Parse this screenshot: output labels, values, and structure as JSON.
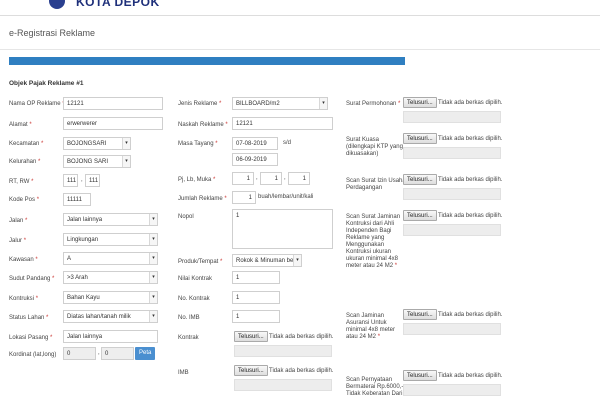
{
  "header": {
    "logo_text": "KOTA DEPOK"
  },
  "page": {
    "title": "e-Registrasi Reklame",
    "progress_percent": 100
  },
  "section": {
    "title": "Objek Pajak Reklame #1"
  },
  "left": {
    "nama_op": {
      "label": "Nama OP Reklame",
      "value": "12121"
    },
    "alamat": {
      "label": "Alamat",
      "value": "erwerwerer"
    },
    "kecamatan": {
      "label": "Kecamatan",
      "value": "BOJONGSARI"
    },
    "kelurahan": {
      "label": "Kelurahan",
      "value": "BOJONG SARI"
    },
    "rtrw": {
      "label": "RT, RW",
      "rt": "111",
      "rw": "111",
      "sep": ","
    },
    "kodepos": {
      "label": "Kode Pos",
      "value": "11111"
    },
    "jalan": {
      "label": "Jalan",
      "value": "Jalan lainnya"
    },
    "jalur": {
      "label": "Jalur",
      "value": "Lingkungan"
    },
    "kawasan": {
      "label": "Kawasan",
      "value": "A"
    },
    "sudut": {
      "label": "Sudut Pandang",
      "value": ">3 Arah"
    },
    "konstruksi": {
      "label": "Kontruksi",
      "value": "Bahan Kayu"
    },
    "status_lahan": {
      "label": "Status Lahan",
      "value": "Diatas lahan/tanah milik"
    },
    "lokasi": {
      "label": "Lokasi Pasang",
      "value": "Jalan lainnya"
    },
    "koordinat": {
      "label": "Kordinat (lat,long)",
      "lat": "0",
      "long": "0",
      "sep": ",",
      "button": "Peta"
    }
  },
  "mid": {
    "jenis": {
      "label": "Jenis Reklame",
      "value": "BILLBOARD/m2"
    },
    "naskah": {
      "label": "Naskah Reklame",
      "value": "12121"
    },
    "masa": {
      "label": "Masa Tayang",
      "from": "07-08-2019",
      "sd": "s/d",
      "to": "06-09-2019"
    },
    "plm": {
      "label": "Pj, Lb, Muka",
      "p": "1",
      "l": "1",
      "m": "1",
      "sep": ","
    },
    "jumlah": {
      "label": "Jumlah Reklame",
      "value": "1",
      "unit": "buah/lembar/unit/kali"
    },
    "nopol": {
      "label": "Nopol",
      "value": "1"
    },
    "produk": {
      "label": "Produk/Tempat",
      "value": "Rokok & Minuman beral"
    },
    "nilai_kontrak": {
      "label": "Nilai Kontrak",
      "value": "1"
    },
    "no_kontrak": {
      "label": "No. Kontrak",
      "value": "1"
    },
    "no_imb": {
      "label": "No. IMB",
      "value": "1"
    },
    "kontrak_file": {
      "label": "Kontrak",
      "button": "Telusuri...",
      "status": "Tidak ada berkas dipilih."
    },
    "imb_file": {
      "label": "IMB",
      "button": "Telusuri...",
      "status": "Tidak ada berkas dipilih."
    }
  },
  "right": {
    "surat_permohonan": {
      "label": "Surat Permohonan",
      "button": "Telusuri...",
      "status": "Tidak ada berkas dipilih."
    },
    "surat_kuasa": {
      "label_line1": "Surat Kuasa",
      "label_line2": "(dilengkapi KTP yang",
      "label_line3": "dikuasakan)",
      "button": "Telusuri...",
      "status": "Tidak ada berkas dipilih."
    },
    "izin_usaha": {
      "label_line1": "Scan Surat Izin Usaha",
      "label_line2": "Perdagangan",
      "button": "Telusuri...",
      "status": "Tidak ada berkas dipilih."
    },
    "jaminan_kontruksi": {
      "label_lines": [
        "Scan Surat Jaminan",
        "Kontruksi dari Ahli",
        "Independen Bagi",
        "Reklame yang",
        "Menggunakan",
        "Kontruksi ukuran",
        "ukuran minimal 4x8",
        "meter atau 24 M2"
      ],
      "button": "Telusuri...",
      "status": "Tidak ada berkas dipilih."
    },
    "jaminan_asuransi": {
      "label_lines": [
        "Scan Jaminan",
        "Asuransi Untuk",
        "minimal 4x8 meter",
        "atau 24 M2"
      ],
      "button": "Telusuri...",
      "status": "Tidak ada berkas dipilih."
    },
    "pernyataan": {
      "label_lines": [
        "Scan Pernyataan",
        "Bermaterai Rp.6000,-",
        "Tidak Keberatan Dari"
      ],
      "button": "Telusuri...",
      "status": "Tidak ada berkas dipilih."
    }
  }
}
